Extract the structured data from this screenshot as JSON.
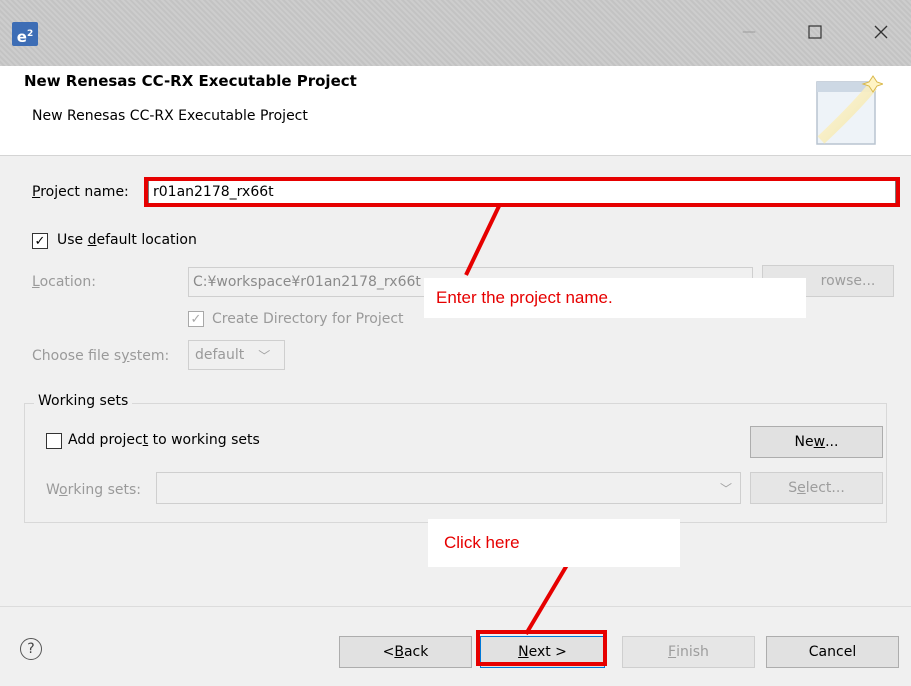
{
  "window": {
    "icon_text": "e",
    "icon_sup": "2",
    "minimize": "—",
    "maximize": "☐",
    "close": "✕"
  },
  "header": {
    "title": "New Renesas CC-RX Executable Project",
    "subtitle": "New Renesas CC-RX Executable Project"
  },
  "form": {
    "project_name_label_u": "P",
    "project_name_label_rest": "roject name:",
    "project_name_value": "r01an2178_rx66t",
    "use_default_pre": "Use ",
    "use_default_u": "d",
    "use_default_post": "efault location",
    "location_label_u": "L",
    "location_label_rest": "ocation:",
    "location_value": "C:¥workspace¥r01an2178_rx66t",
    "browse_label": "rowse...",
    "create_dir_label": "Create Directory for Project",
    "file_system_label_pre": "Choose file s",
    "file_system_label_u": "y",
    "file_system_label_post": "stem:",
    "file_system_value": "default"
  },
  "working_sets": {
    "group_title": "Working sets",
    "add_pre": "Add projec",
    "add_u": "t",
    "add_post": " to working sets",
    "new_pre": "Ne",
    "new_u": "w",
    "new_post": "...",
    "sets_label_pre": "W",
    "sets_label_u": "o",
    "sets_label_post": "rking sets:",
    "select_pre": "S",
    "select_u": "e",
    "select_post": "lect..."
  },
  "footer": {
    "help": "?",
    "back_pre": "< ",
    "back_u": "B",
    "back_post": "ack",
    "next_u": "N",
    "next_post": "ext >",
    "finish_u": "F",
    "finish_post": "inish",
    "cancel": "Cancel"
  },
  "annotations": {
    "callout_name": "Enter the project name.",
    "callout_click": "Click here",
    "color": "#e60000"
  }
}
